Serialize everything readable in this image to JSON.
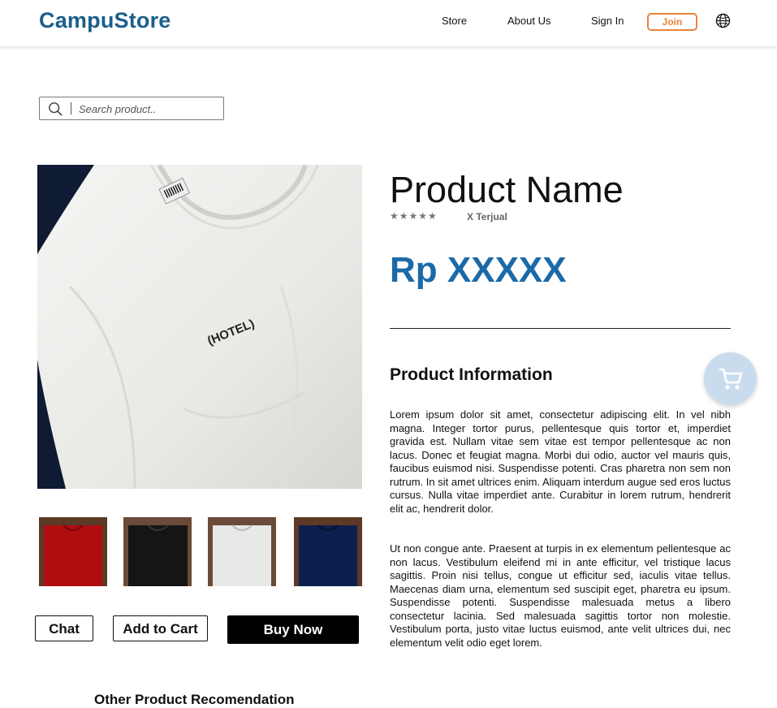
{
  "header": {
    "brand": "CampuStore",
    "nav": {
      "store": "Store",
      "about": "About Us",
      "signin": "Sign In",
      "join": "Join"
    },
    "globe_icon": "globe-icon"
  },
  "search": {
    "placeholder": "Search product..",
    "icon": "search-icon"
  },
  "product": {
    "name": "Product Name",
    "rating_stars": "★★★★★",
    "sold": "X Terjual",
    "price": "Rp XXXXX",
    "shirt_label": "(HOTEL)",
    "thumbnails": [
      "red t-shirt",
      "black t-shirt",
      "white t-shirt",
      "navy t-shirt"
    ]
  },
  "actions": {
    "chat": "Chat",
    "add_to_cart": "Add to Cart",
    "buy_now": "Buy Now"
  },
  "info": {
    "title": "Product Information",
    "paragraph1": "Lorem ipsum dolor sit amet, consectetur adipiscing elit. In vel nibh magna. Integer tortor purus, pellentesque quis tortor et, imperdiet gravida est. Nullam vitae sem vitae est tempor pellentesque ac non lacus. Donec et feugiat magna. Morbi dui odio, auctor vel mauris quis, faucibus euismod nisi. Suspendisse potenti. Cras pharetra non sem non rutrum. In sit amet ultrices enim. Aliquam interdum augue sed eros luctus cursus. Nulla vitae imperdiet ante. Curabitur in lorem rutrum, hendrerit elit ac, hendrerit dolor.",
    "paragraph2": "Ut non congue ante. Praesent at turpis in ex elementum pellentesque ac non lacus. Vestibulum eleifend mi in ante efficitur, vel tristique lacus sagittis. Proin nisi tellus, congue ut efficitur sed, iaculis vitae tellus. Maecenas diam urna, elementum sed suscipit eget, pharetra eu ipsum. Suspendisse potenti. Suspendisse malesuada metus a libero consectetur lacinia. Sed malesuada sagittis tortor non molestie. Vestibulum porta, justo vitae luctus euismod, ante velit ultrices dui, nec elementum velit odio eget lorem."
  },
  "recommendation": {
    "title": "Other Product Recomendation"
  },
  "colors": {
    "brand": "#1b5e8c",
    "price": "#1b6aa8",
    "join": "#e8843b",
    "fab": "#c9dced"
  }
}
